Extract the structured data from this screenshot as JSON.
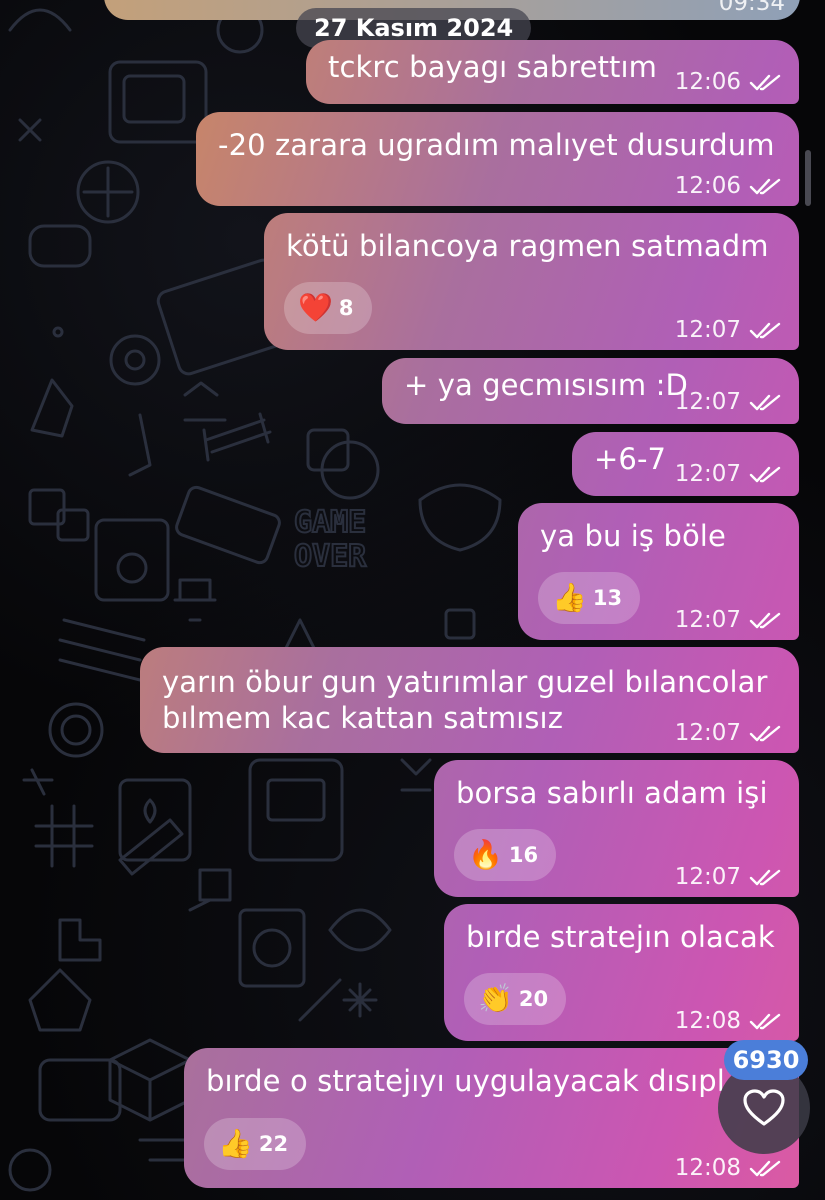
{
  "previous_message": {
    "time": "09:34"
  },
  "date_separator": "27 Kasım 2024",
  "messages": [
    {
      "text": "tckrc bayagı sabrettım",
      "time": "12:06"
    },
    {
      "text": "-20 zarara ugradım malıyet dusurdum",
      "time": "12:06"
    },
    {
      "text": "kötü bilancoya ragmen satmadm",
      "time": "12:07",
      "reaction": {
        "emoji": "❤️",
        "count": "8"
      }
    },
    {
      "text": "+ ya gecmısısım :D",
      "time": "12:07"
    },
    {
      "text": "+6-7",
      "time": "12:07"
    },
    {
      "text": "ya bu iş böle",
      "time": "12:07",
      "reaction": {
        "emoji": "👍",
        "count": "13"
      }
    },
    {
      "text_line1": "yarın öbur gun yatırımlar guzel bılancolar",
      "text_line2": "bılmem kac kattan satmısız",
      "time": "12:07"
    },
    {
      "text": "borsa sabırlı adam işi",
      "time": "12:07",
      "reaction": {
        "emoji": "🔥",
        "count": "16"
      }
    },
    {
      "text": "bırde stratejın olacak",
      "time": "12:08",
      "reaction": {
        "emoji": "👏",
        "count": "20"
      }
    },
    {
      "text": "bırde o stratejıyı uygulayacak dısıpl",
      "time": "12:08",
      "reaction": {
        "emoji": "👍",
        "count": "22"
      }
    }
  ],
  "unread_badge": "6930",
  "icons": {
    "read_status": "double-check-icon",
    "scroll_button": "heart-outline-icon"
  },
  "colors": {
    "background": "#060608",
    "bubble_gradient_start": "#d89a5c",
    "bubble_gradient_mid": "#b05fb6",
    "bubble_gradient_end": "#dd5ba0",
    "badge": "#4b7ed9"
  }
}
